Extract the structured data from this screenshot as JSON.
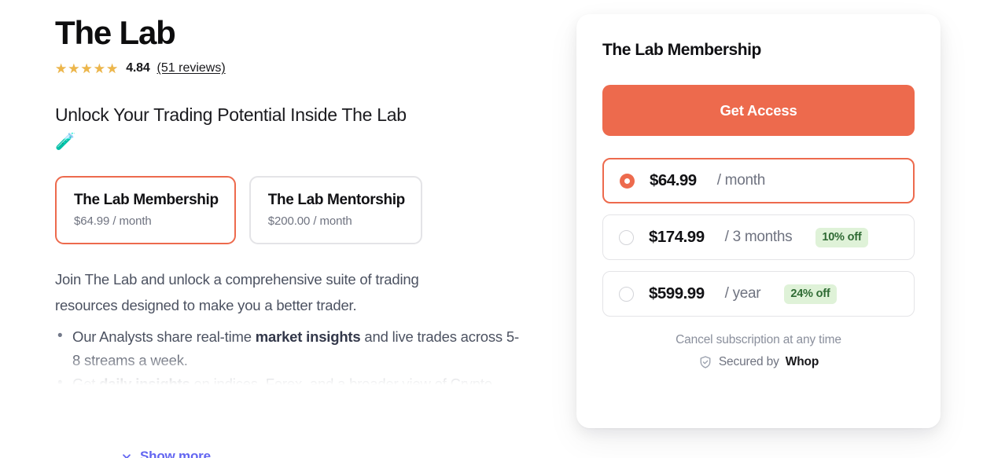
{
  "product": {
    "title": "The Lab",
    "rating": {
      "stars_full": "★★★★★",
      "value": "4.84",
      "fill_percent": 96.8,
      "reviews_label": "(51 reviews)"
    },
    "headline": "Unlock Your Trading Potential Inside The Lab",
    "headline_emoji": "🧪"
  },
  "plans": [
    {
      "name": "The Lab Membership",
      "price": "$64.99 / month",
      "selected": true
    },
    {
      "name": "The Lab Mentorship",
      "price": "$200.00 / month",
      "selected": false
    }
  ],
  "description": {
    "paragraph": "Join The Lab and unlock a comprehensive suite of trading resources designed to make you a better trader.",
    "bullets": [
      {
        "pre": "Our Analysts share real-time ",
        "bold": "market insights",
        "post": " and live trades across 5-8 streams a week."
      },
      {
        "pre": "Get ",
        "bold": "daily insights",
        "post": " on indices, Forex, and a broader view of Crypto markets."
      }
    ]
  },
  "show_more": {
    "label": "Show more",
    "icon": "chevron-down-icon"
  },
  "checkout": {
    "title": "The Lab Membership",
    "cta_label": "Get Access",
    "options": [
      {
        "price": "$64.99",
        "period": "/ month",
        "badge": "",
        "selected": true
      },
      {
        "price": "$174.99",
        "period": "/ 3 months",
        "badge": "10% off",
        "selected": false
      },
      {
        "price": "$599.99",
        "period": "/ year",
        "badge": "24% off",
        "selected": false
      }
    ],
    "cancel_note": "Cancel subscription at any time",
    "secured_prefix": "Secured by",
    "secured_brand": "Whop",
    "secured_icon": "shield-check-icon"
  },
  "colors": {
    "accent": "#ed6a4d",
    "badge_bg": "#dff2d8",
    "badge_text": "#2f6b34",
    "link": "#6366f1",
    "star": "#edb64b"
  }
}
